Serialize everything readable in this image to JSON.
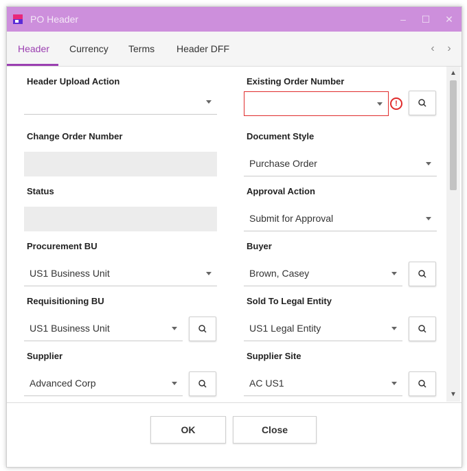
{
  "window": {
    "title": "PO Header",
    "minimize": "–",
    "maximize": "☐",
    "close": "✕"
  },
  "tabs": [
    "Header",
    "Currency",
    "Terms",
    "Header DFF"
  ],
  "nav": {
    "prev": "‹",
    "next": "›"
  },
  "fields": {
    "header_upload_action": {
      "label": "Header Upload Action",
      "value": ""
    },
    "existing_order_number": {
      "label": "Existing Order Number",
      "value": ""
    },
    "change_order_number": {
      "label": "Change Order Number",
      "value": ""
    },
    "document_style": {
      "label": "Document Style",
      "value": "Purchase Order"
    },
    "status": {
      "label": "Status",
      "value": ""
    },
    "approval_action": {
      "label": "Approval Action",
      "value": "Submit for Approval"
    },
    "procurement_bu": {
      "label": "Procurement BU",
      "value": "US1 Business Unit"
    },
    "buyer": {
      "label": "Buyer",
      "value": "Brown, Casey"
    },
    "requisitioning_bu": {
      "label": "Requisitioning BU",
      "value": "US1 Business Unit"
    },
    "sold_to_legal_entity": {
      "label": "Sold To Legal Entity",
      "value": "US1 Legal Entity"
    },
    "supplier": {
      "label": "Supplier",
      "value": "Advanced Corp"
    },
    "supplier_site": {
      "label": "Supplier Site",
      "value": "AC US1"
    }
  },
  "error_mark": "!",
  "scroll": {
    "up": "▲",
    "down": "▼"
  },
  "buttons": {
    "ok": "OK",
    "close": "Close"
  },
  "colors": {
    "titlebar": "#cd8fdc",
    "accent": "#9b3fb1",
    "error": "#e02b2b"
  }
}
